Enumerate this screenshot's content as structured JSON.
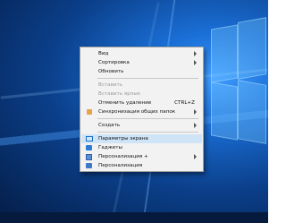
{
  "context_menu": {
    "items": [
      {
        "label": "Вид",
        "submenu": true
      },
      {
        "label": "Сортировка",
        "submenu": true
      },
      {
        "label": "Обновить"
      },
      {
        "label": "Вставить",
        "disabled": true
      },
      {
        "label": "Вставить ярлык",
        "disabled": true
      },
      {
        "label": "Отменить удаление",
        "shortcut": "CTRL+Z"
      },
      {
        "label": "Синхронизация общих папок",
        "submenu": true,
        "icon": "sync-icon"
      },
      {
        "label": "Создать",
        "submenu": true
      },
      {
        "label": "Параметры экрана",
        "icon": "display-settings-icon",
        "highlighted": true
      },
      {
        "label": "Гаджеты",
        "icon": "gadgets-icon"
      },
      {
        "label": "Персонализация +",
        "icon": "nvidia-icon",
        "submenu": true
      },
      {
        "label": "Персонализация",
        "icon": "personalization-icon"
      }
    ]
  },
  "colors": {
    "desktop_blue": "#0b3f8a",
    "menu_background": "#f2f2f2",
    "highlight": "#cfe4f7"
  }
}
